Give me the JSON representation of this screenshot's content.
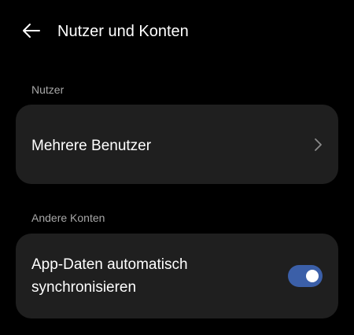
{
  "header": {
    "title": "Nutzer und Konten",
    "back_icon": "arrow-left-icon"
  },
  "sections": [
    {
      "header": "Nutzer",
      "item": {
        "label": "Mehrere Benutzer",
        "trailing_icon": "chevron-right-icon"
      }
    },
    {
      "header": "Andere Konten",
      "item": {
        "label_line1": "App-Daten automatisch",
        "label_line2": "synchronisieren",
        "toggle_on": true
      }
    }
  ],
  "colors": {
    "background": "#000000",
    "card": "#1f1f1f",
    "section_header": "#a8a8a8",
    "toggle_on": "#3b5fa8"
  }
}
